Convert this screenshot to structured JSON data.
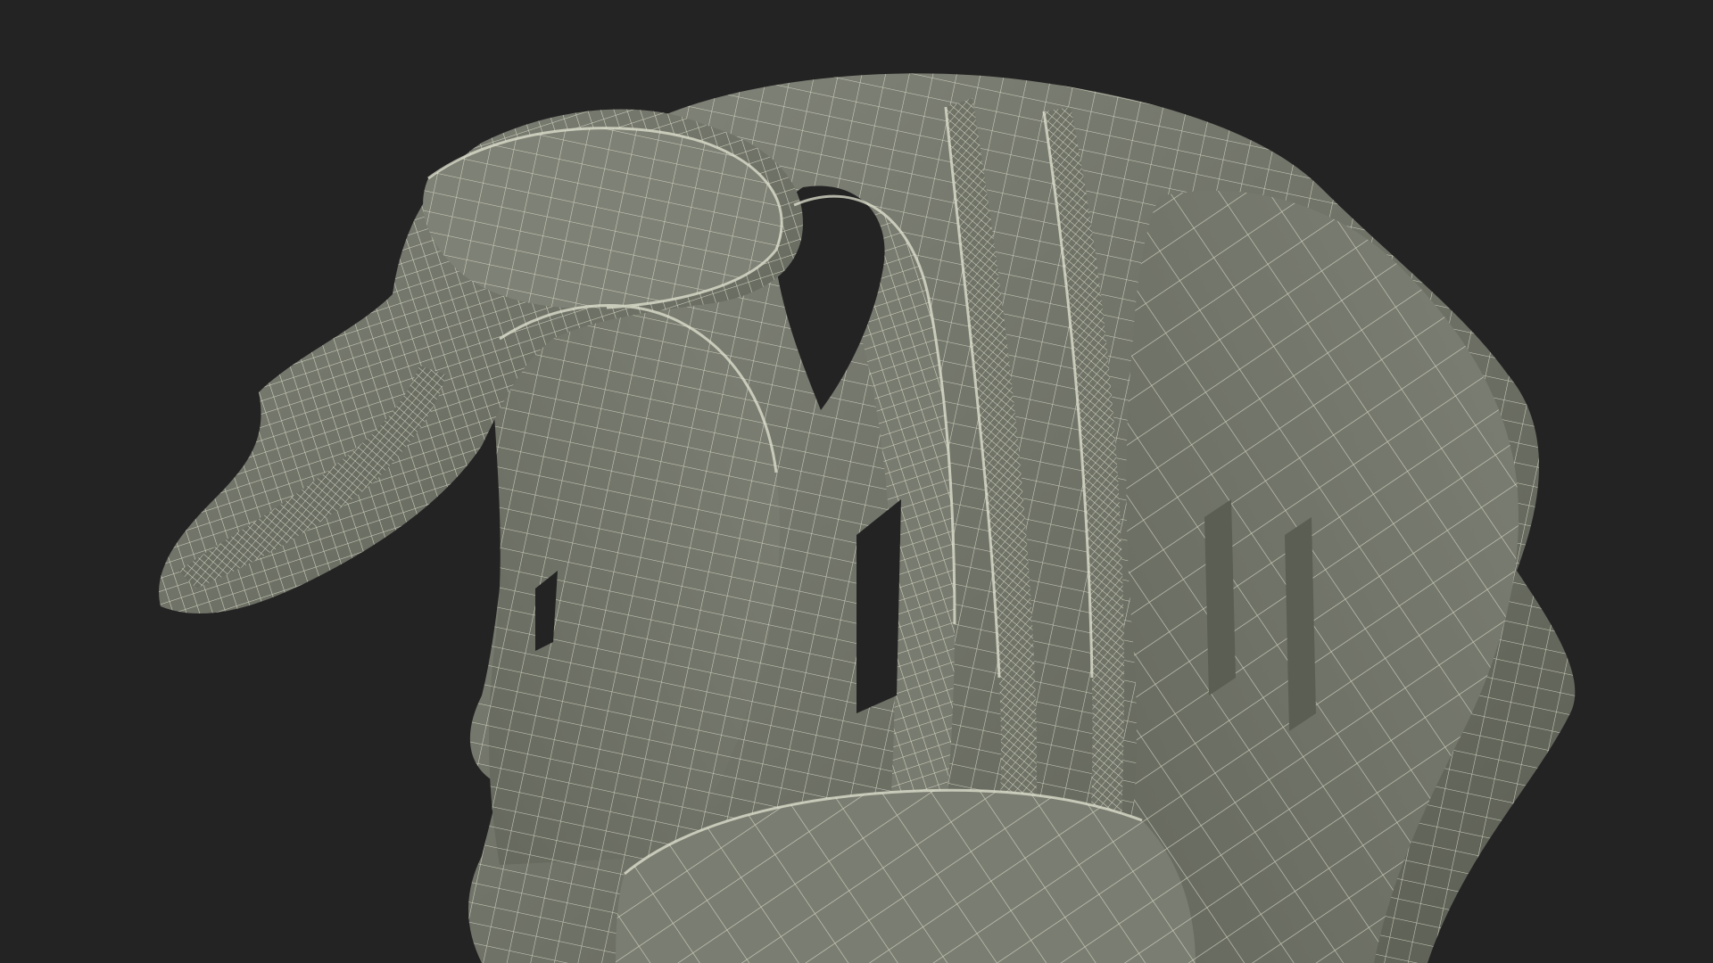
{
  "scene": {
    "background_color": "#232323",
    "surface_color": "#74776a",
    "surface_shadow_color": "#5b5e53",
    "surface_highlight_color": "#8a8d80",
    "wire_color": "#e4e6d3",
    "subject": "wireframe-mesh-render"
  }
}
